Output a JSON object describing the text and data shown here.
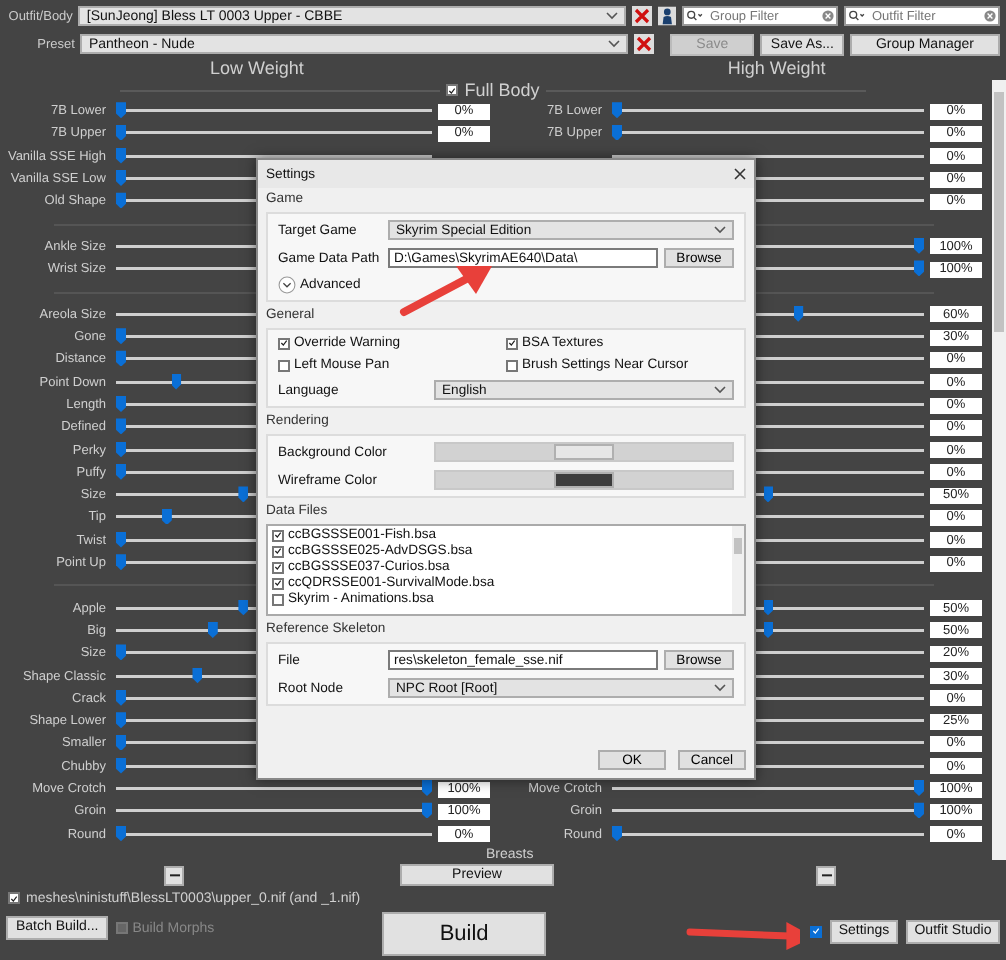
{
  "top": {
    "outfit_label": "Outfit/Body",
    "outfit_value": "[SunJeong] Bless LT 0003 Upper - CBBE",
    "preset_label": "Preset",
    "preset_value": "Pantheon - Nude",
    "group_filter": {
      "placeholder": "Group Filter"
    },
    "outfit_filter": {
      "placeholder": "Outfit Filter"
    },
    "buttons": [
      {
        "label": "Save",
        "disabled": true
      },
      {
        "label": "Save As...",
        "disabled": false
      },
      {
        "label": "Group Manager",
        "disabled": false
      }
    ]
  },
  "headers": {
    "low": "Low Weight",
    "high": "High Weight"
  },
  "full_body": {
    "label": "Full Body",
    "checked": true
  },
  "groups": [
    [
      {
        "left": {
          "label": "7B Lower",
          "level": 0,
          "value": "0%"
        },
        "right": {
          "label": "7B Lower",
          "level": 0,
          "value": "0%"
        }
      },
      {
        "left": {
          "label": "7B Upper",
          "level": 0,
          "value": "0%"
        },
        "right": {
          "label": "7B Upper",
          "level": 0,
          "value": "0%"
        }
      },
      {
        "left": {
          "label": "Vanilla SSE High",
          "level": 0
        },
        "right": {
          "value": "0%"
        }
      },
      {
        "left": {
          "label": "Vanilla SSE Low",
          "level": 0
        },
        "right": {
          "value": "0%"
        }
      },
      {
        "left": {
          "label": "Old Shape",
          "level": 0
        },
        "right": {
          "value": "0%"
        }
      }
    ],
    [
      {
        "left": {
          "label": "Ankle Size"
        },
        "right": {
          "level": 1,
          "value": "100%"
        }
      },
      {
        "left": {
          "label": "Wrist Size"
        },
        "right": {
          "level": 1,
          "value": "100%"
        }
      }
    ],
    [
      {
        "left": {
          "label": "Areola Size"
        },
        "right": {
          "level": 0.6,
          "value": "60%"
        }
      },
      {
        "left": {
          "label": "Gone",
          "level": 0
        },
        "right": {
          "value": "30%"
        }
      },
      {
        "left": {
          "label": "Distance",
          "level": 0
        },
        "right": {
          "value": "0%"
        }
      },
      {
        "left": {
          "label": "Point Down",
          "level": 0.18
        },
        "right": {
          "value": "0%"
        }
      },
      {
        "left": {
          "label": "Length",
          "level": 0
        },
        "right": {
          "value": "0%"
        }
      },
      {
        "left": {
          "label": "Defined",
          "level": 0
        },
        "right": {
          "value": "0%"
        }
      },
      {
        "left": {
          "label": "Perky",
          "level": 0
        },
        "right": {
          "value": "0%"
        }
      },
      {
        "left": {
          "label": "Puffy",
          "level": 0
        },
        "right": {
          "value": "0%"
        }
      },
      {
        "left": {
          "label": "Size",
          "level": 0.4
        },
        "right": {
          "level": 0.5,
          "value": "50%"
        }
      },
      {
        "left": {
          "label": "Tip",
          "level": 0.15
        },
        "right": {
          "value": "0%"
        }
      },
      {
        "left": {
          "label": "Twist",
          "level": 0
        },
        "right": {
          "value": "0%"
        }
      },
      {
        "left": {
          "label": "Point Up",
          "level": 0
        },
        "right": {
          "value": "0%"
        }
      }
    ],
    [
      {
        "left": {
          "label": "Apple",
          "level": 0.4
        },
        "right": {
          "level": 0.5,
          "value": "50%"
        }
      },
      {
        "left": {
          "label": "Big",
          "level": 0.3
        },
        "right": {
          "level": 0.5,
          "value": "50%"
        }
      },
      {
        "left": {
          "label": "Size",
          "level": 0
        },
        "right": {
          "value": "20%"
        }
      },
      {
        "left": {
          "label": "Shape Classic",
          "level": 0.25
        },
        "right": {
          "value": "30%"
        }
      },
      {
        "left": {
          "label": "Crack",
          "level": 0
        },
        "right": {
          "value": "0%"
        }
      },
      {
        "left": {
          "label": "Shape Lower",
          "level": 0
        },
        "right": {
          "value": "25%"
        }
      },
      {
        "left": {
          "label": "Smaller",
          "level": 0
        },
        "right": {
          "value": "0%"
        }
      },
      {
        "left": {
          "label": "Chubby",
          "level": 0
        },
        "right": {
          "value": "0%"
        }
      },
      {
        "left": {
          "label": "Move Crotch",
          "level": 1,
          "value": "100%"
        },
        "right": {
          "label": "Move Crotch",
          "level": 1,
          "value": "100%"
        }
      },
      {
        "left": {
          "label": "Groin",
          "level": 1,
          "value": "100%"
        },
        "right": {
          "label": "Groin",
          "level": 1,
          "value": "100%"
        }
      },
      {
        "left": {
          "label": "Round",
          "level": 0,
          "value": "0%"
        },
        "right": {
          "label": "Round",
          "level": 0,
          "value": "0%"
        }
      }
    ]
  ],
  "section": {
    "label": "Breasts"
  },
  "preview": "Preview",
  "output": {
    "checked": true,
    "path": "meshes\\ninistuff\\BlessLT0003\\upper_0.nif (and _1.nif)"
  },
  "footer": {
    "batch": "Batch Build...",
    "build_morphs": {
      "label": "Build Morphs",
      "checked": false,
      "disabled": true
    },
    "build": "Build",
    "option": {
      "checked": true
    },
    "settings": "Settings",
    "outfit_studio": "Outfit Studio"
  },
  "settings": {
    "title": "Settings",
    "game": {
      "title": "Game",
      "target_label": "Target Game",
      "target_value": "Skyrim Special Edition",
      "path_label": "Game Data Path",
      "path_value": "D:\\Games\\SkyrimAE640\\Data\\",
      "browse": "Browse",
      "advanced": "Advanced"
    },
    "general": {
      "title": "General",
      "options": [
        {
          "label": "Override Warning",
          "checked": true
        },
        {
          "label": "BSA Textures",
          "checked": true
        },
        {
          "label": "Left Mouse Pan",
          "checked": false
        },
        {
          "label": "Brush Settings Near Cursor",
          "checked": false
        }
      ],
      "language_label": "Language",
      "language_value": "English"
    },
    "rendering": {
      "title": "Rendering",
      "colors": [
        {
          "label": "Background Color",
          "color": "#e6e6e6"
        },
        {
          "label": "Wireframe Color",
          "color": "#3c3c3c"
        }
      ]
    },
    "data_files": {
      "title": "Data Files",
      "files": [
        {
          "label": "ccBGSSSE001-Fish.bsa",
          "checked": true
        },
        {
          "label": "ccBGSSSE025-AdvDSGS.bsa",
          "checked": true
        },
        {
          "label": "ccBGSSSE037-Curios.bsa",
          "checked": true
        },
        {
          "label": "ccQDRSSE001-SurvivalMode.bsa",
          "checked": true
        },
        {
          "label": "Skyrim - Animations.bsa",
          "checked": false
        }
      ]
    },
    "skeleton": {
      "title": "Reference Skeleton",
      "file_label": "File",
      "file_value": "res\\skeleton_female_sse.nif",
      "browse": "Browse",
      "root_label": "Root Node",
      "root_value": "NPC Root [Root]"
    },
    "buttons": [
      "OK",
      "Cancel"
    ]
  }
}
